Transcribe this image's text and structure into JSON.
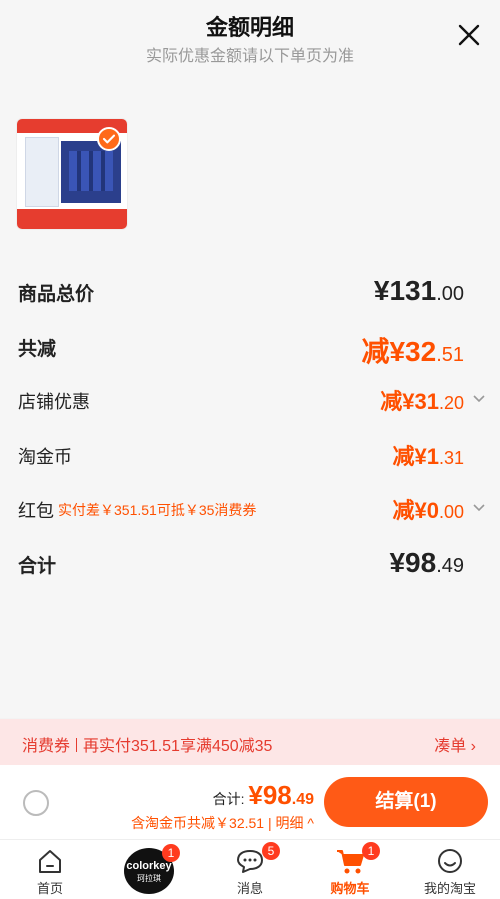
{
  "header": {
    "title": "金额明细",
    "subtitle": "实际优惠金额请以下单页为准",
    "close_icon": "close-icon"
  },
  "product": {
    "image_icon": "milk-box-product-thumbnail",
    "selected_icon": "checkmark-icon"
  },
  "rows": [
    {
      "label": "商品总价",
      "value_main": "¥131",
      "value_dec": ".00"
    },
    {
      "label": "共减",
      "value_main": "减¥32",
      "value_dec": ".51"
    },
    {
      "label": "店铺优惠",
      "value_main": "减¥31",
      "value_dec": ".20"
    },
    {
      "label": "淘金币",
      "value_main": "减¥1",
      "value_dec": ".31"
    },
    {
      "label": "红包",
      "note": "实付差￥351.51可抵￥35消费券",
      "value_main": "减¥0",
      "value_dec": ".00"
    },
    {
      "label": "合计",
      "value_main": "¥98",
      "value_dec": ".49"
    }
  ],
  "promo": {
    "tag": "消费券",
    "text": "再实付351.51享满450减35",
    "action": "凑单 ›"
  },
  "checkout": {
    "total_label": "合计:",
    "total_main": "¥98",
    "total_dec": ".49",
    "discount_text": "含淘金币共减￥32.51",
    "detail_link": "明细 ^",
    "pay_button": "结算(1)"
  },
  "tabs": [
    {
      "label": "首页",
      "icon": "home-icon"
    },
    {
      "label": "",
      "icon": "colorkey-brand-logo",
      "brand_main": "colorkey",
      "brand_sub": "珂拉琪",
      "badge": "1"
    },
    {
      "label": "消息",
      "icon": "message-icon",
      "badge": "5"
    },
    {
      "label": "购物车",
      "icon": "cart-icon",
      "badge": "1"
    },
    {
      "label": "我的淘宝",
      "icon": "profile-face-icon"
    }
  ],
  "colors": {
    "accent": "#ff5000",
    "button": "#ff5a16",
    "promo_bg": "#fde6e6",
    "promo_text": "#e53b2f"
  }
}
